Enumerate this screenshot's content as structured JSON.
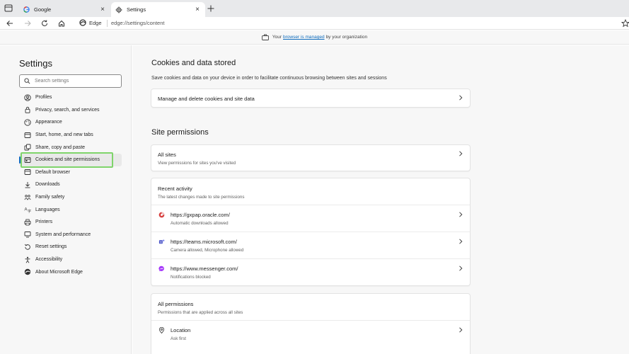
{
  "tabs": [
    {
      "title": "Google",
      "icon": "google-icon"
    },
    {
      "title": "Settings",
      "icon": "gear-icon"
    }
  ],
  "toolbar": {
    "edge_label": "Edge",
    "url": "edge://settings/content"
  },
  "managed_bar": {
    "prefix": "Your",
    "link": "browser is managed",
    "suffix": "by your organization"
  },
  "sidebar": {
    "title": "Settings",
    "search_placeholder": "Search settings",
    "items": [
      {
        "label": "Profiles",
        "icon": "profile-icon"
      },
      {
        "label": "Privacy, search, and services",
        "icon": "lock-icon"
      },
      {
        "label": "Appearance",
        "icon": "appearance-icon"
      },
      {
        "label": "Start, home, and new tabs",
        "icon": "home-icon"
      },
      {
        "label": "Share, copy and paste",
        "icon": "share-icon"
      },
      {
        "label": "Cookies and site permissions",
        "icon": "cookies-icon",
        "active": true
      },
      {
        "label": "Default browser",
        "icon": "browser-icon"
      },
      {
        "label": "Downloads",
        "icon": "download-icon"
      },
      {
        "label": "Family safety",
        "icon": "family-icon"
      },
      {
        "label": "Languages",
        "icon": "languages-icon"
      },
      {
        "label": "Printers",
        "icon": "printer-icon"
      },
      {
        "label": "System and performance",
        "icon": "system-icon"
      },
      {
        "label": "Reset settings",
        "icon": "reset-icon"
      },
      {
        "label": "Accessibility",
        "icon": "accessibility-icon"
      },
      {
        "label": "About Microsoft Edge",
        "icon": "edge-icon"
      }
    ]
  },
  "main": {
    "cookies_section": {
      "title": "Cookies and data stored",
      "description": "Save cookies and data on your device in order to facilitate continuous browsing between sites and sessions",
      "manage_label": "Manage and delete cookies and site data"
    },
    "site_permissions": {
      "title": "Site permissions",
      "all_sites": {
        "label": "All sites",
        "sub": "View permissions for sites you've visited"
      },
      "recent_activity": {
        "title": "Recent activity",
        "sub": "The latest changes made to site permissions",
        "sites": [
          {
            "url": "https://gxpap.oracle.com/",
            "detail": "Automatic downloads allowed",
            "icon": "oracle-site-icon"
          },
          {
            "url": "https://teams.microsoft.com/",
            "detail": "Camera allowed, Microphone allowed",
            "icon": "teams-icon"
          },
          {
            "url": "https://www.messenger.com/",
            "detail": "Notifications blocked",
            "icon": "messenger-icon"
          }
        ]
      },
      "all_permissions": {
        "title": "All permissions",
        "sub": "Permissions that are applied across all sites",
        "items": [
          {
            "label": "Location",
            "sub": "Ask first",
            "icon": "location-icon"
          }
        ]
      }
    }
  },
  "colors": {
    "accent": "#0f6cbd",
    "highlight": "#7fd46b"
  }
}
